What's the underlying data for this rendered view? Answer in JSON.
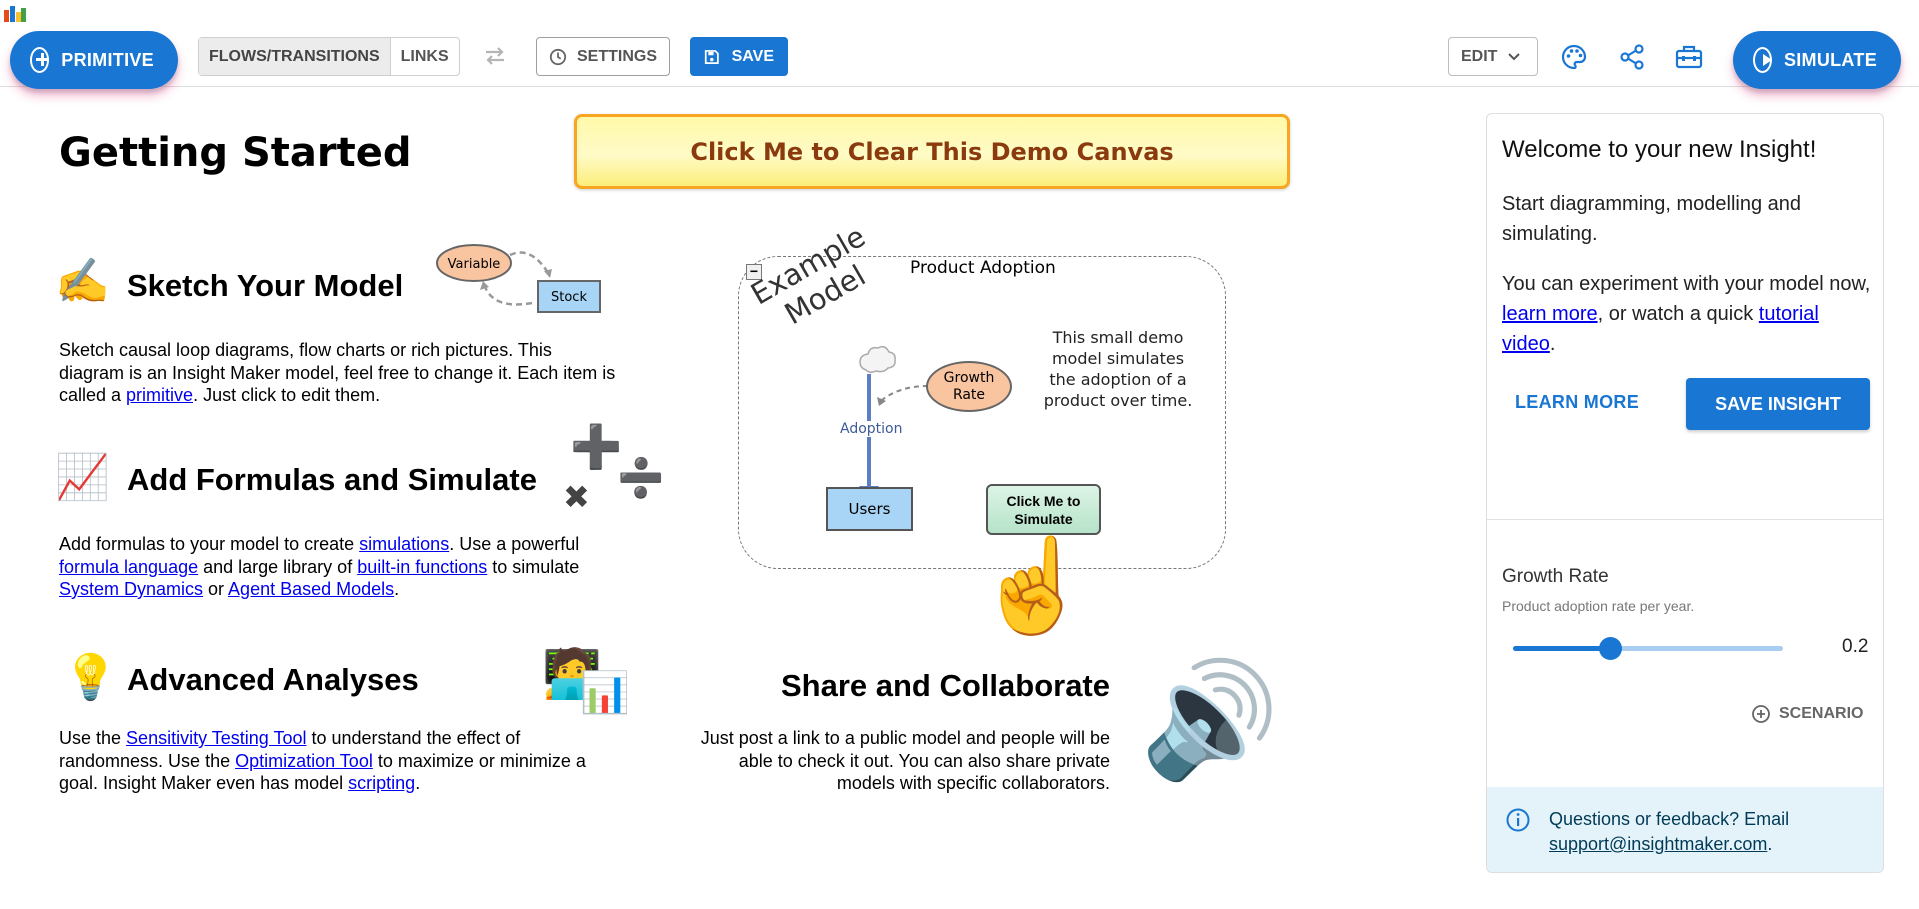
{
  "toolbar": {
    "primitive_label": "PRIMITIVE",
    "flows_label": "FLOWS/TRANSITIONS",
    "links_label": "LINKS",
    "settings_label": "SETTINGS",
    "save_label": "SAVE",
    "edit_label": "EDIT",
    "simulate_label": "SIMULATE",
    "icons": [
      "app-logo",
      "plus-circle-icon",
      "swap-arrows-icon",
      "clock-icon",
      "floppy-disk-icon",
      "chevron-down-icon",
      "palette-icon",
      "share-icon",
      "toolbox-icon",
      "play-circle-icon"
    ]
  },
  "main": {
    "title": "Getting Started",
    "demo_button": "Click Me to Clear This Demo Canvas",
    "sketch": {
      "heading": "Sketch Your Model",
      "text_1": "Sketch causal loop diagrams, flow charts or rich pictures. This diagram is an Insight Maker model, feel free to change it. Each item is called a ",
      "link_1": "primitive",
      "text_2": ". Just click to edit them.",
      "mini_variable": "Variable",
      "mini_stock": "Stock"
    },
    "formulas": {
      "heading": "Add Formulas and Simulate",
      "t1": "Add formulas to your model to create ",
      "l1": "simulations",
      "t2": ". Use a powerful ",
      "l2": "formula language",
      "t3": " and large library of ",
      "l3": "built-in functions",
      "t4": " to simulate ",
      "l4": "System Dynamics",
      "t5": " or ",
      "l5": "Agent Based Models",
      "t6": "."
    },
    "advanced": {
      "heading": "Advanced Analyses",
      "t1": "Use the ",
      "l1": "Sensitivity Testing Tool",
      "t2": " to understand the effect of randomness. Use the ",
      "l2": "Optimization Tool",
      "t3": " to maximize or minimize a goal. Insight Maker even has model ",
      "l3": "scripting",
      "t4": "."
    },
    "share": {
      "heading": "Share and Collaborate",
      "text": "Just post a link to a public model and people will be able to check it out. You can also share private models with specific collaborators."
    },
    "diagram": {
      "folder_title": "Product Adoption",
      "example_line1": "Example",
      "example_line2": "Model",
      "growth_line1": "Growth",
      "growth_line2": "Rate",
      "flow_label": "Adoption",
      "stock_label": "Users",
      "sim_btn_line1": "Click Me to",
      "sim_btn_line2": "Simulate",
      "note_lines": [
        "This small demo",
        "model simulates",
        "the adoption of a",
        "product over time."
      ],
      "collapse_symbol": "−"
    },
    "emojis": {
      "writing_hand": "✍️",
      "chart": "📈",
      "bulb": "💡",
      "technologist": "🧑‍💻",
      "bar_chart": "📊",
      "pointing_up": "☝️",
      "speaker": "🔊",
      "plus": "➕",
      "multiply": "✖",
      "divide": "➗"
    }
  },
  "panel": {
    "heading": "Welcome to your new Insight!",
    "p1": "Start diagramming, modelling and simulating.",
    "p2_a": "You can experiment with your model now, ",
    "p2_link1": "learn more",
    "p2_b": ", or watch a quick ",
    "p2_link2": "tutorial video",
    "p2_c": ".",
    "learn_more": "LEARN MORE",
    "save_insight": "SAVE INSIGHT",
    "growth_label": "Growth Rate",
    "growth_desc": "Product adoption rate per year.",
    "growth_value": "0.2",
    "slider_fraction": 0.36,
    "scenario_label": "SCENARIO",
    "info_text": "Questions or feedback? Email ",
    "info_email": "support@insightmaker.com",
    "info_end": "."
  },
  "colors": {
    "primary": "#1976d2",
    "demo_border": "#f6a623",
    "demo_text": "#8a3a0c",
    "stock_fill": "#a8d4f5",
    "variable_fill": "#f9c4a0",
    "button_fill": "#bfe9d2",
    "flow_color": "#5b7ec4",
    "info_bg": "#e4f3f9"
  }
}
